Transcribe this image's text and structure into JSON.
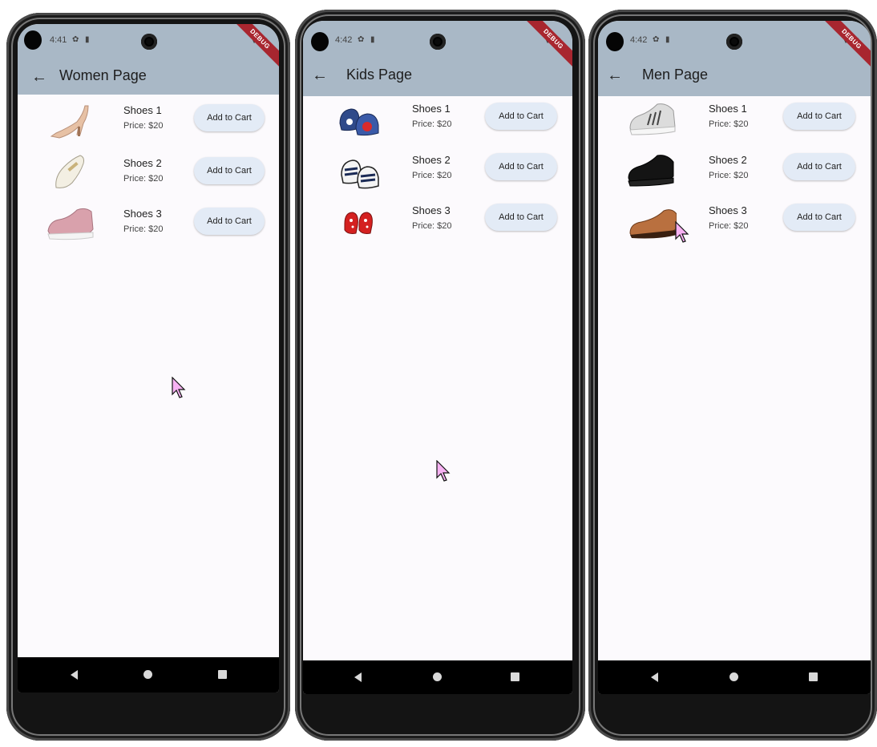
{
  "phones": [
    {
      "id": "women",
      "time": "4:41",
      "debug_label": "DEBUG",
      "title": "Women Page",
      "items": [
        {
          "name": "Shoes 1",
          "price": "Price: $20",
          "button": "Add to Cart",
          "icon": "heel-shoe-icon"
        },
        {
          "name": "Shoes 2",
          "price": "Price: $20",
          "button": "Add to Cart",
          "icon": "loafer-shoe-icon"
        },
        {
          "name": "Shoes 3",
          "price": "Price: $20",
          "button": "Add to Cart",
          "icon": "pink-sneaker-icon"
        }
      ]
    },
    {
      "id": "kids",
      "time": "4:42",
      "debug_label": "DEBUG",
      "title": "Kids Page",
      "items": [
        {
          "name": "Shoes 1",
          "price": "Price: $20",
          "button": "Add to Cart",
          "icon": "baby-shoe-icon"
        },
        {
          "name": "Shoes 2",
          "price": "Price: $20",
          "button": "Add to Cart",
          "icon": "baby-sneaker-icon"
        },
        {
          "name": "Shoes 3",
          "price": "Price: $20",
          "button": "Add to Cart",
          "icon": "red-baby-shoe-icon"
        }
      ]
    },
    {
      "id": "men",
      "time": "4:42",
      "debug_label": "DEBUG",
      "title": "Men Page",
      "items": [
        {
          "name": "Shoes 1",
          "price": "Price: $20",
          "button": "Add to Cart",
          "icon": "grey-sneaker-icon"
        },
        {
          "name": "Shoes 2",
          "price": "Price: $20",
          "button": "Add to Cart",
          "icon": "black-sneaker-icon"
        },
        {
          "name": "Shoes 3",
          "price": "Price: $20",
          "button": "Add to Cart",
          "icon": "brown-formal-shoe-icon"
        }
      ]
    }
  ],
  "colors": {
    "appbar": "#a9b8c6",
    "screen_background": "#fcfafd",
    "button_background": "#e3ebf6",
    "debug_banner": "#a8262f",
    "cursor_fill": "#f7b2f3"
  }
}
